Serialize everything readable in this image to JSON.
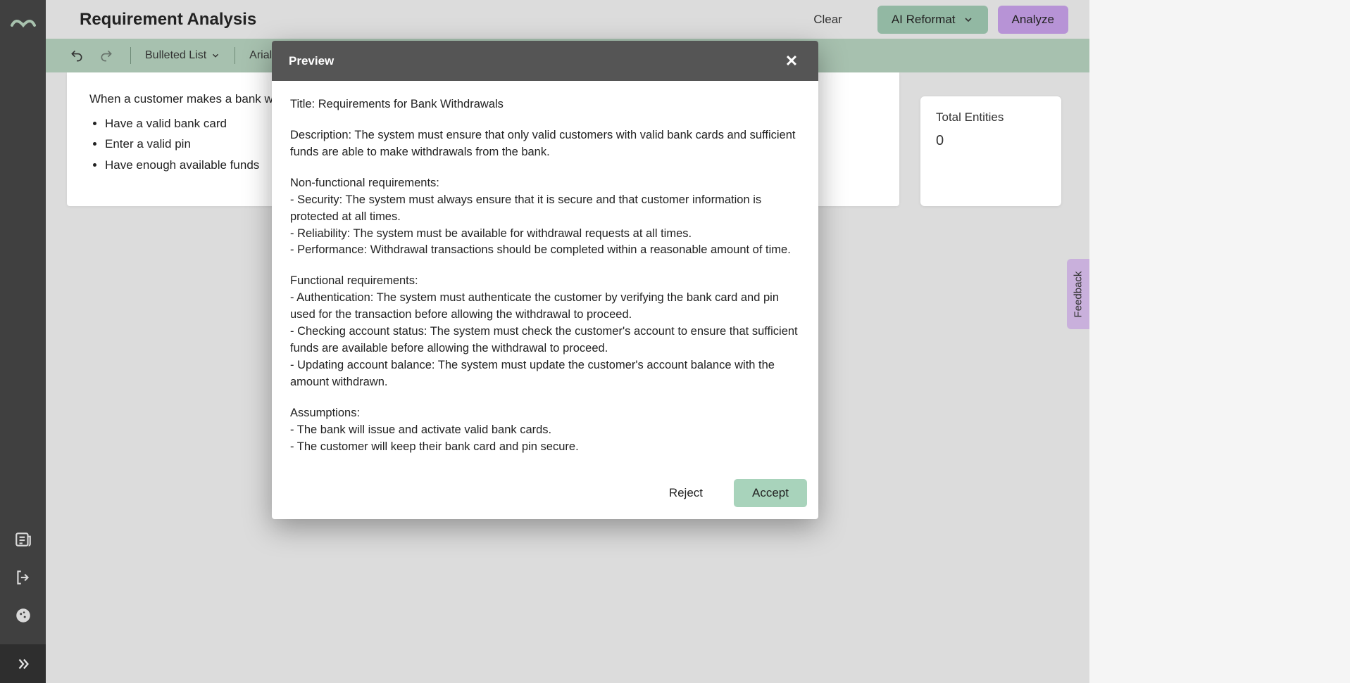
{
  "header": {
    "title": "Requirement Analysis",
    "clear_label": "Clear",
    "reformat_label": "AI Reformat",
    "analyze_label": "Analyze"
  },
  "toolbar": {
    "list_style": "Bulleted List",
    "font": "Arial"
  },
  "editor": {
    "intro": "When a customer makes a bank withdrawal, they must:",
    "bullets": [
      "Have a valid bank card",
      "Enter a valid pin",
      "Have enough available funds"
    ]
  },
  "entities": {
    "label": "Total Entities",
    "value": "0"
  },
  "modal": {
    "title": "Preview",
    "reject_label": "Reject",
    "accept_label": "Accept",
    "body": {
      "p1": "Title: Requirements for Bank Withdrawals",
      "p2": "Description: The system must ensure that only valid customers with valid bank cards and sufficient funds are able to make withdrawals from the bank.",
      "p3": "Non-functional requirements:\n- Security: The system must always ensure that it is secure and that customer information is protected at all times.\n- Reliability: The system must be available for withdrawal requests at all times.\n- Performance: Withdrawal transactions should be completed within a reasonable amount of time.",
      "p4": "Functional requirements:\n- Authentication: The system must authenticate the customer by verifying the bank card and pin used for the transaction before allowing the withdrawal to proceed.\n- Checking account status: The system must check the customer's account to ensure that sufficient funds are available before allowing the withdrawal to proceed.\n- Updating account balance: The system must update the customer's account balance with the amount withdrawn.",
      "p5": "Assumptions:\n- The bank will issue and activate valid bank cards.\n- The customer will keep their bank card and pin secure."
    }
  },
  "feedback": {
    "label": "Feedback"
  }
}
